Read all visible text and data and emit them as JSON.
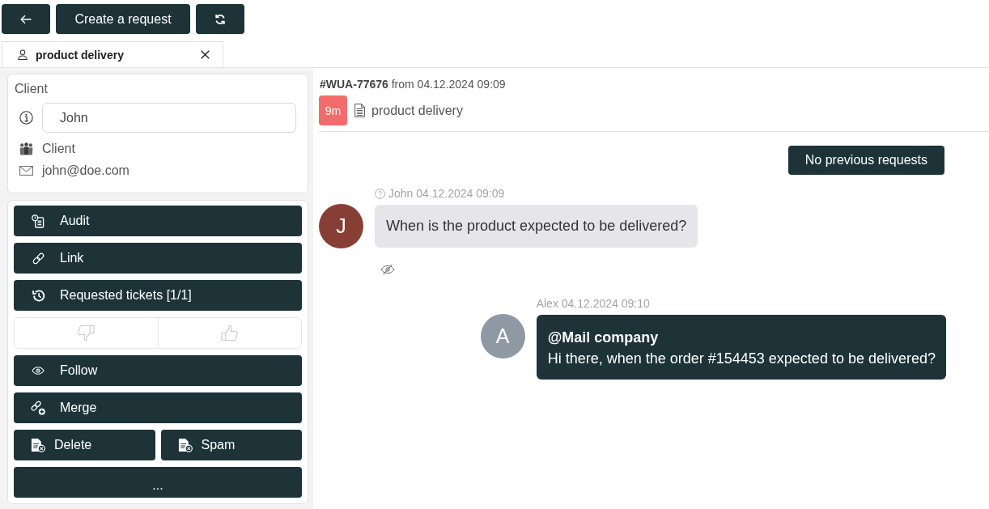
{
  "toolbar": [
    {
      "kind": "back"
    },
    {
      "kind": "create",
      "label": "Create a request"
    },
    {
      "kind": "refresh"
    }
  ],
  "tabs": [
    {
      "label": "product delivery",
      "selected": true
    }
  ],
  "client": {
    "title": "Client",
    "name": "John",
    "type": "Client",
    "email": "john@doe.com"
  },
  "actions": [
    {
      "kind": "audit",
      "label": "Audit"
    },
    {
      "kind": "link",
      "label": "Link"
    },
    {
      "kind": "history",
      "label": "Requested tickets [1/1]"
    },
    {
      "kind": "rating",
      "options": [
        {
          "kind": "dislike",
          "selected": false
        },
        {
          "kind": "like",
          "selected": false
        }
      ]
    },
    {
      "kind": "follow",
      "label": "Follow"
    },
    {
      "kind": "merge",
      "label": "Merge"
    },
    {
      "kind": "pair",
      "buttons": [
        {
          "label": "Delete"
        },
        {
          "label": "Spam"
        }
      ]
    },
    {
      "kind": "more",
      "label": "..."
    }
  ],
  "ticket": {
    "id_line": "**#WUA-77676** from 04.12.2024 09:09",
    "age": "9m",
    "subject": "product delivery"
  },
  "history_button": "No previous requests",
  "messages": [
    {
      "kind": "incoming",
      "avatar": "J",
      "color": "#873f35",
      "meta": "John 04.12.2024 09:09",
      "text": "When is the product expected to be delivered?",
      "seen": false
    },
    {
      "kind": "outgoing",
      "avatar": "A",
      "color": "#8f99a4",
      "meta": "Alex 04.12.2024 09:10",
      "mention": "@Mail company",
      "text": "Hi there, when the order #154453 expected to be delivered?"
    }
  ]
}
